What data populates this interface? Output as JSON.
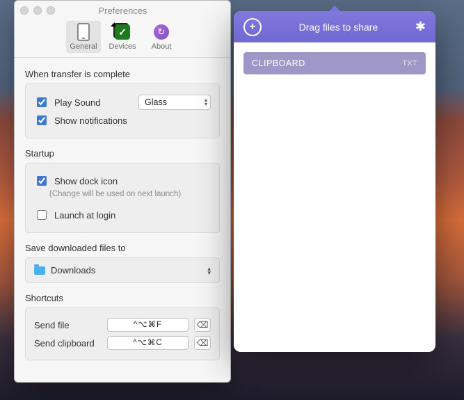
{
  "window": {
    "title": "Preferences"
  },
  "tabs": {
    "general": "General",
    "devices": "Devices",
    "about": "About"
  },
  "sections": {
    "transfer_heading": "When transfer is complete",
    "startup_heading": "Startup",
    "save_heading": "Save downloaded files to",
    "shortcuts_heading": "Shortcuts"
  },
  "transfer": {
    "play_sound_label": "Play Sound",
    "play_sound_checked": true,
    "sound_value": "Glass",
    "show_notifications_label": "Show notifications",
    "show_notifications_checked": true
  },
  "startup": {
    "dock_icon_label": "Show dock icon",
    "dock_icon_checked": true,
    "dock_note": "(Change will be used on next launch)",
    "launch_login_label": "Launch at login",
    "launch_login_checked": false
  },
  "save": {
    "folder_name": "Downloads"
  },
  "shortcuts": {
    "send_file_label": "Send file",
    "send_file_keys": "^⌥⌘F",
    "send_clipboard_label": "Send clipboard",
    "send_clipboard_keys": "^⌥⌘C"
  },
  "share": {
    "header_text": "Drag files to share",
    "clip_title": "CLIPBOARD",
    "clip_tag": "TXT"
  }
}
